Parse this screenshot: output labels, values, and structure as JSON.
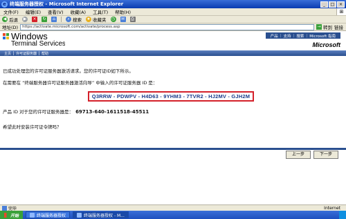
{
  "window": {
    "title": "终端服务器授权 - Microsoft Internet Explorer",
    "buttons": [
      "_",
      "□",
      "×"
    ]
  },
  "menubar": {
    "items": [
      "文件(F)",
      "编辑(E)",
      "查看(V)",
      "收藏(A)",
      "工具(T)",
      "帮助(H)"
    ]
  },
  "toolbar": {
    "back": "后退",
    "search": "搜索",
    "favorites": "收藏夹"
  },
  "addressbar": {
    "label": "地址(D)",
    "url": "https://activate.microsoft.com/activate/process.asp",
    "go": "转到",
    "links": "链接"
  },
  "page": {
    "logo_line1": "Windows",
    "logo_line2": "Terminal Services",
    "top_nav": [
      "产品",
      "支持",
      "搜索",
      "Microsoft 指南"
    ],
    "brand": "Microsoft",
    "breadcrumbs": [
      "主页",
      "许可证服务器",
      "帮助"
    ],
    "message1": "已成功处理您的许可证服务器激活请求。您的许可证ID如下所示。",
    "message2": "在需要在 “终端服务器许可证服务器激活向导” 中输入的许可证服务器 ID 是：",
    "license_key": "Q3RRW - PDWPV - H4D63 - 9YHM3 - 7TVR2 - HJ2MV - GJH2M",
    "pid_label": "产品 ID 对于您的许可证服务器是：",
    "pid_value": "69713-640-1611518-45511",
    "question": "希望此时安装许可证令牌吗？",
    "button_back": "上一步",
    "button_next": "下一步"
  },
  "statusbar": {
    "text": "完毕",
    "zone": "Internet"
  },
  "taskbar": {
    "start": "开始",
    "tasks": [
      "终端服务器授权",
      "终端服务器授权 - M..."
    ]
  }
}
